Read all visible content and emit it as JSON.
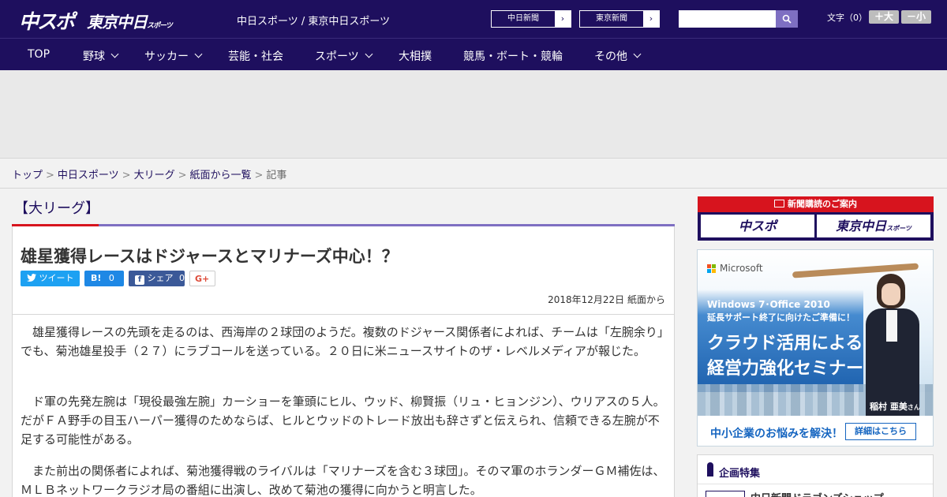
{
  "header": {
    "logo_main": "中スポ",
    "logo_tokyo": "東京中日",
    "logo_tokyo_small": "スポーツ",
    "site_title": "中日スポーツ / 東京中日スポーツ",
    "ext_links": [
      {
        "label": "中日新聞",
        "arrow": "›"
      },
      {
        "label": "東京新聞",
        "arrow": "›"
      }
    ],
    "search": {
      "value": "",
      "placeholder": "",
      "button_icon": "search-icon"
    },
    "font_size": {
      "label": "文字（0）",
      "bigger": "＋大",
      "smaller": "－小"
    }
  },
  "nav": {
    "items": [
      {
        "label": "TOP",
        "dropdown": false
      },
      {
        "label": "野球",
        "dropdown": true
      },
      {
        "label": "サッカー",
        "dropdown": true
      },
      {
        "label": "芸能・社会",
        "dropdown": false
      },
      {
        "label": "スポーツ",
        "dropdown": true
      },
      {
        "label": "大相撲",
        "dropdown": false
      },
      {
        "label": "競馬・ボート・競輪",
        "dropdown": false
      },
      {
        "label": "その他",
        "dropdown": true
      }
    ]
  },
  "breadcrumb": {
    "items": [
      "トップ",
      "中日スポーツ",
      "大リーグ",
      "紙面から一覧"
    ],
    "current": "記事",
    "separator": ">"
  },
  "article": {
    "category": "【大リーグ】",
    "headline": "雄星獲得レースはドジャースとマリナーズ中心！？",
    "share": {
      "tweet": "ツイート",
      "hatena": "B!",
      "hatena_count": "0",
      "facebook": "シェア",
      "facebook_count": "0",
      "gplus": "G+"
    },
    "date": "2018年12月22日 紙面から",
    "paragraphs": [
      "　雄星獲得レースの先頭を走るのは、西海岸の２球団のようだ。複数のドジャース関係者によれば、チームは「左腕余り」でも、菊池雄星投手（２７）にラブコールを送っている。２０日に米ニュースサイトのザ・レベルメディアが報じた。",
      "　ド軍の先発左腕は「現役最強左腕」カーショーを筆頭にヒル、ウッド、柳賢振（リュ・ヒョンジン）、ウリアスの５人。だがＦＡ野手の目玉ハーパー獲得のためならば、ヒルとウッドのトレード放出も辞さずと伝えられ、信頼できる左腕が不足する可能性がある。",
      "　また前出の関係者によれば、菊池獲得戦のライバルは「マリナーズを含む３球団」。そのマ軍のホランダーＧＭ補佐は、ＭＬＢネットワークラジオ局の番組に出演し、改めて菊池の獲得に向かうと明言した。"
    ]
  },
  "sidebar": {
    "subscription": {
      "heading": "新聞購読のご案内",
      "buttons": [
        "中スポ",
        "東京中日"
      ],
      "button_small": "スポーツ"
    },
    "ad": {
      "brand": "Microsoft",
      "line1": "Windows 7･Office 2010",
      "line2": "延長サポート終了に向けたご準備に！",
      "line3": "クラウド活用による",
      "line4": "経営力強化セミナー",
      "person": "稲村 亜美",
      "person_suffix": "さん",
      "footer_text": "中小企業のお悩みを解決！",
      "footer_button": "詳細はこちら",
      "colors": {
        "ms_red": "#f25022",
        "ms_green": "#7fba00",
        "ms_blue": "#00a4ef",
        "ms_yellow": "#ffb900"
      }
    },
    "feature": {
      "title": "企画特集",
      "first_item": "中日新聞ドラゴンズショップ"
    }
  },
  "colors": {
    "brand_navy": "#1e0f5e",
    "accent_red": "#d7141e",
    "accent_purple": "#7e6fc2"
  }
}
